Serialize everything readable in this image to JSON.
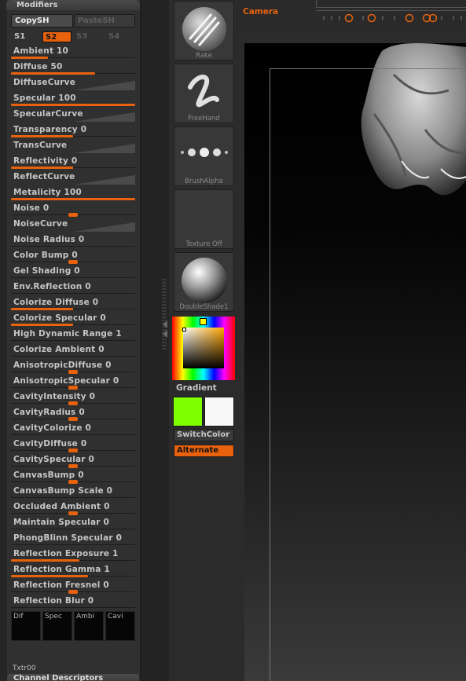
{
  "panel": {
    "title": "Modifiers",
    "copy_label": "CopySH",
    "paste_label": "PasteSH",
    "slots": [
      "S1",
      "S2",
      "S3",
      "S4"
    ],
    "active_slot": "S2",
    "accent": "#e8620e"
  },
  "modifiers": [
    {
      "label": "Ambient 10",
      "level": 0.3
    },
    {
      "label": "Diffuse 50",
      "level": 0.68
    },
    {
      "label": "DiffuseCurve"
    },
    {
      "label": "Specular 100",
      "level": 1.0
    },
    {
      "label": "SpecularCurve"
    },
    {
      "label": "Transparency 0",
      "level": 0.5
    },
    {
      "label": "TransCurve"
    },
    {
      "label": "Reflectivity 0",
      "level": 0.5
    },
    {
      "label": "ReflectCurve"
    },
    {
      "label": "Metalicity 100",
      "level": 1.0
    },
    {
      "label": "Noise 0",
      "knob": 0.5
    },
    {
      "label": "NoiseCurve"
    },
    {
      "label": "Noise Radius 0"
    },
    {
      "label": "Color Bump 0",
      "knob": 0.5
    },
    {
      "label": "Gel Shading 0"
    },
    {
      "label": "Env.Reflection 0"
    },
    {
      "label": "Colorize Diffuse 0",
      "level": 0.5
    },
    {
      "label": "Colorize Specular 0",
      "level": 0.5
    },
    {
      "label": "High Dynamic Range 1"
    },
    {
      "label": "Colorize Ambient 0"
    },
    {
      "label": "AnisotropicDiffuse 0",
      "knob": 0.5
    },
    {
      "label": "AnisotropicSpecular 0",
      "knob": 0.5
    },
    {
      "label": "CavityIntensity 0",
      "knob": 0.5
    },
    {
      "label": "CavityRadius 0",
      "knob": 0.5
    },
    {
      "label": "CavityColorize 0"
    },
    {
      "label": "CavityDiffuse 0",
      "knob": 0.5
    },
    {
      "label": "CavitySpecular 0",
      "knob": 0.5
    },
    {
      "label": "CanvasBump 0",
      "knob": 0.5
    },
    {
      "label": "CanvasBump Scale 0"
    },
    {
      "label": "Occluded  Ambient 0",
      "knob": 0.5
    },
    {
      "label": "Maintain Specular 0"
    },
    {
      "label": "PhongBlinn Specular 0"
    },
    {
      "label": "Reflection Exposure 1",
      "level": 0.55
    },
    {
      "label": "Reflection Gamma 1",
      "level": 0.62
    },
    {
      "label": "Reflection Fresnel 0",
      "knob": 0.5
    },
    {
      "label": "Reflection Blur 0"
    }
  ],
  "channels": [
    "Dif",
    "Spec",
    "Ambi",
    "Cavi"
  ],
  "texture_label": "Txtr00",
  "channel_bar": "Channel Descriptors",
  "tools": [
    {
      "caption": "Rake",
      "icon": "rake-brush-icon"
    },
    {
      "caption": "FreeHand",
      "icon": "freehand-stroke-icon"
    },
    {
      "caption": "BrushAlpha",
      "icon": "brush-alpha-icon"
    },
    {
      "caption": "Texture Off",
      "icon": "texture-off-icon"
    },
    {
      "caption": "DoubleShade1",
      "icon": "material-sphere-icon"
    }
  ],
  "color": {
    "gradient_label": "Gradient",
    "main": "#7fff00",
    "secondary": "#f8f8f8",
    "switch_label": "SwitchColor",
    "alternate_label": "Alternate"
  },
  "camera": {
    "label": "Camera"
  }
}
